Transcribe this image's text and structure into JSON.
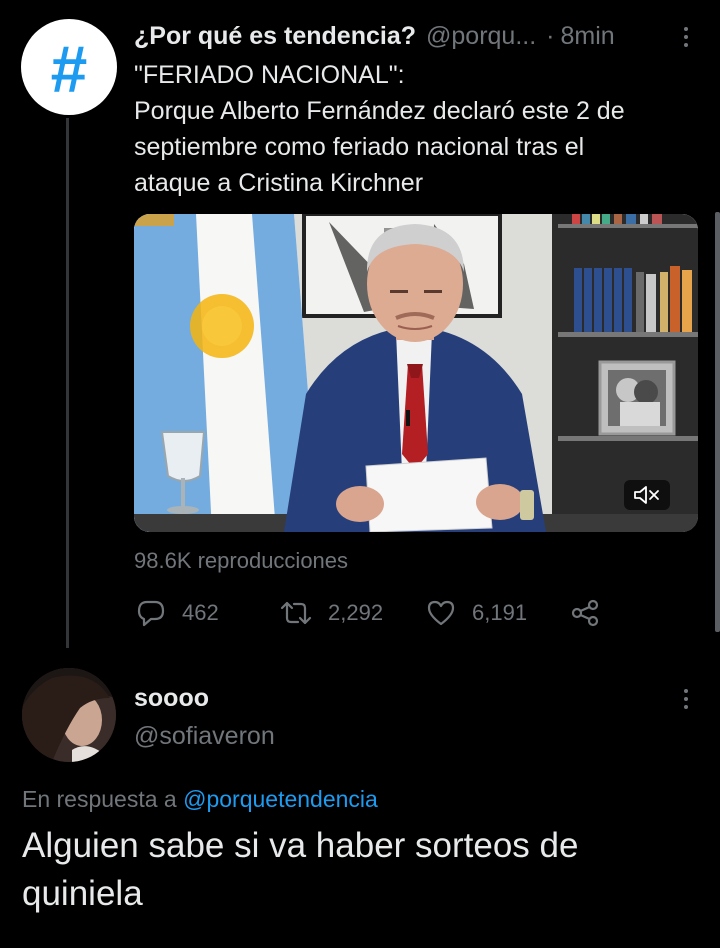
{
  "tweet": {
    "avatar_glyph": "#",
    "name": "¿Por qué es tendencia?",
    "handle": "@porqu...",
    "separator": "·",
    "time": "8min",
    "text_lines": [
      "\"FERIADO NACIONAL\":",
      "Porque Alberto Fernández declaró este 2 de",
      "septiembre como feriado nacional tras el",
      "ataque a Cristina Kirchner"
    ],
    "media_mute_icon": "mute-icon",
    "views": "98.6K reproducciones",
    "actions": {
      "reply": {
        "icon": "reply-icon",
        "count": "462"
      },
      "retweet": {
        "icon": "retweet-icon",
        "count": "2,292"
      },
      "like": {
        "icon": "like-icon",
        "count": "6,191"
      },
      "share": {
        "icon": "share-icon"
      }
    }
  },
  "reply": {
    "name": "soooo",
    "handle": "@sofiaveron",
    "in_reply_prefix": "En respuesta a",
    "in_reply_mention": "@porquetendencia",
    "text_lines": [
      "Alguien sabe si va haber sorteos de",
      "quiniela"
    ]
  },
  "colors": {
    "background": "#000000",
    "text": "#e7e9ea",
    "secondary": "#71767b",
    "accent": "#1d9bf0",
    "thread_line": "#333639"
  }
}
